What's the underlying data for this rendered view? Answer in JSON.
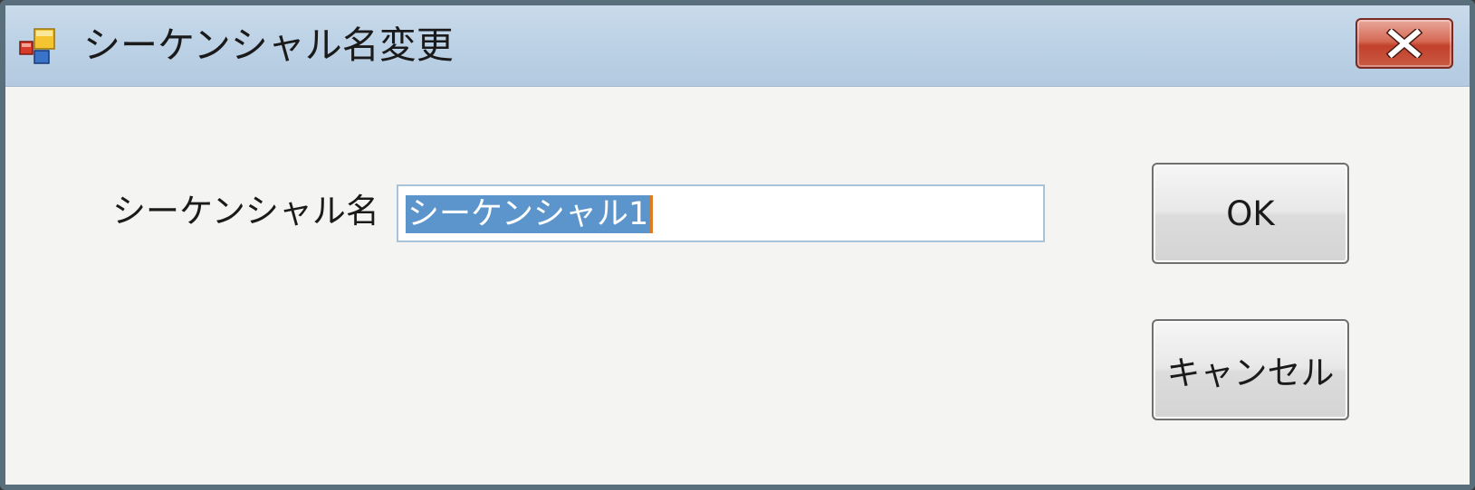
{
  "window": {
    "title": "シーケンシャル名変更",
    "title_bar_color": "#bdd2e6",
    "close_button_color": "#c95a44",
    "icons": {
      "app": "app-window-icon",
      "close": "close-x-icon"
    }
  },
  "form": {
    "label": "シーケンシャル名",
    "input_value": "シーケンシャル1",
    "selection_color": "#5b95cc"
  },
  "buttons": {
    "ok_label": "OK",
    "cancel_label": "キャンセル"
  }
}
